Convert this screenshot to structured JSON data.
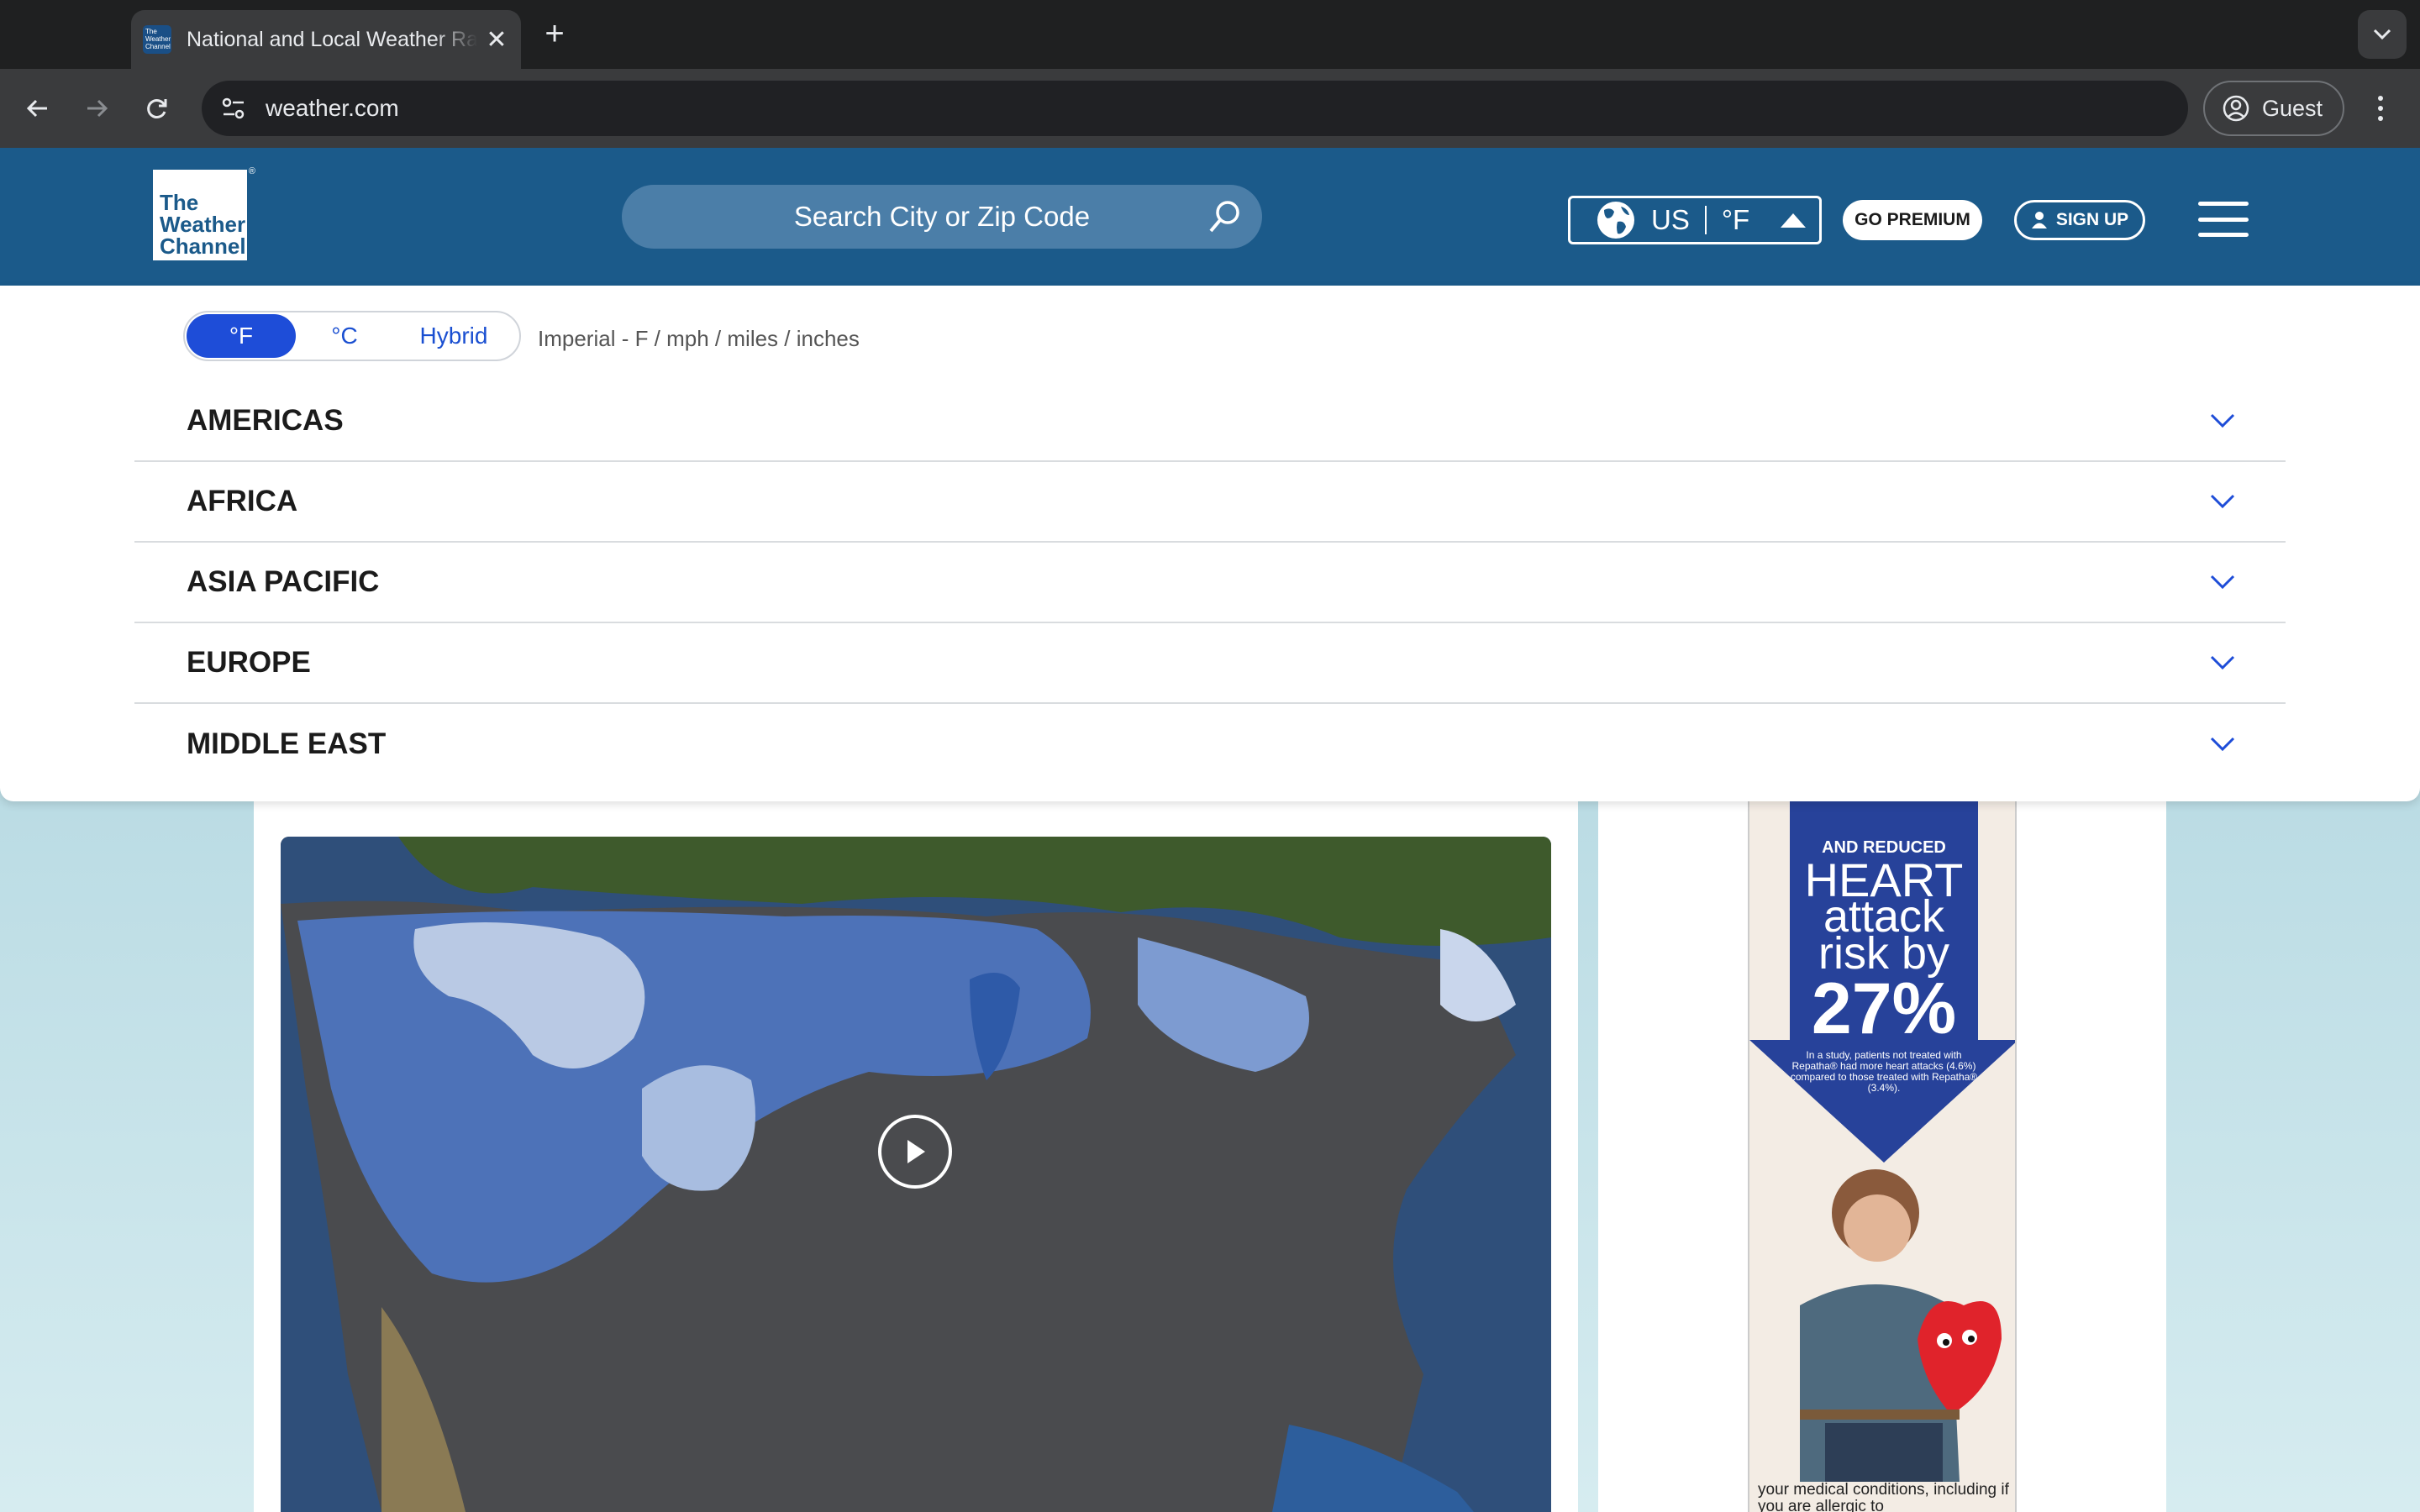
{
  "browser": {
    "tab_title": "National and Local Weather Radar, Daily Forecast, Hurricane and information from The Weather Channel and weather.com",
    "url": "weather.com",
    "profile_label": "Guest",
    "favicon_text": "The Weather Channel"
  },
  "header": {
    "logo_lines": [
      "The",
      "Weather",
      "Channel"
    ],
    "search_placeholder": "Search City or Zip Code",
    "region_country": "US",
    "region_unit": "°F",
    "premium_label": "GO PREMIUM",
    "signup_label": "SIGN UP"
  },
  "units": {
    "options": [
      "°F",
      "°C",
      "Hybrid"
    ],
    "selected": "°F",
    "description": "Imperial - F / mph / miles / inches"
  },
  "regions": [
    "AMERICAS",
    "AFRICA",
    "ASIA PACIFIC",
    "EUROPE",
    "MIDDLE EAST"
  ],
  "ad": {
    "line1": "AND REDUCED",
    "line2": "HEART",
    "line3": "attack",
    "line4": "risk by",
    "line5": "27%",
    "fine_print": "In a study, patients not treated with Repatha® had more heart attacks (4.6%) compared to those treated with Repatha® (3.4%).",
    "bottom_text": "your medical conditions, including if you are allergic to"
  },
  "colors": {
    "header_blue": "#1b5a8a",
    "accent_blue": "#1e4dd8",
    "ad_blue": "#27429a"
  }
}
